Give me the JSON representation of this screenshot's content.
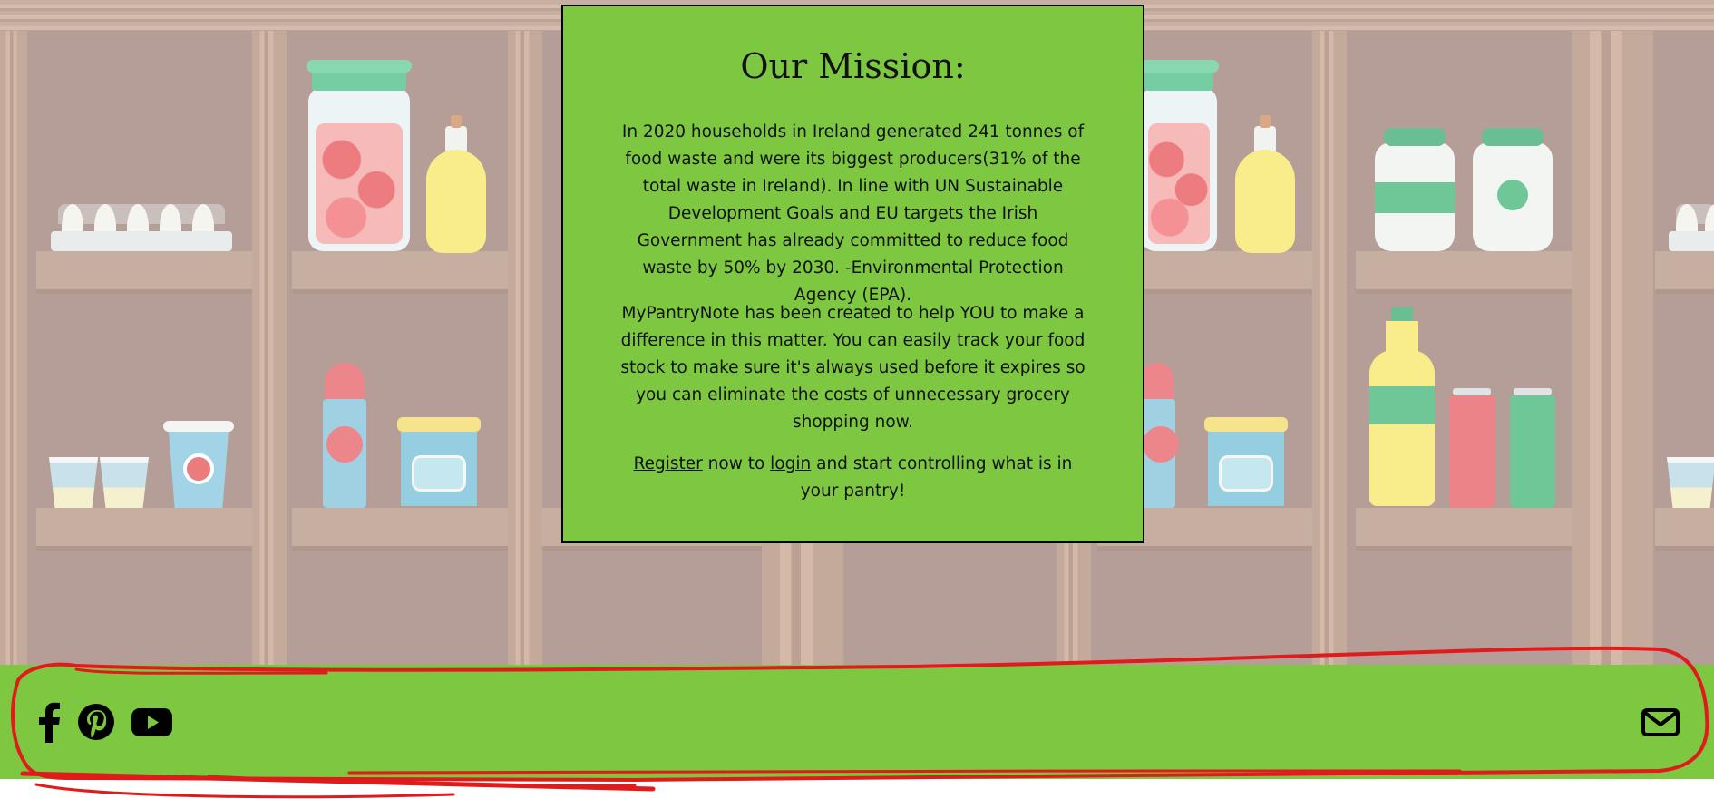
{
  "mission": {
    "title": "Our Mission:",
    "paragraph1": "In 2020 households in Ireland generated 241 tonnes of food waste and were its biggest producers(31% of the total waste in Ireland). In line with UN Sustainable Development Goals and EU targets the Irish Government has already committed to reduce food waste by 50% by 2030. -Environmental Protection Agency (EPA).",
    "paragraph2": "MyPantryNote has been created to help YOU to make a difference in this matter. You can easily track your food stock to make sure it's always used before it expires so you can eliminate the costs of unnecessary grocery shopping now.",
    "cta": {
      "register_link": "Register",
      "text_between": " now to ",
      "login_link": "login",
      "text_after": " and start controlling what is in your pantry!"
    }
  },
  "footer": {
    "social_icons": [
      "facebook-icon",
      "pinterest-icon",
      "youtube-icon"
    ],
    "contact_icon": "envelope-icon"
  },
  "colors": {
    "brand_green": "#7dc741",
    "pantry_wall": "#a1827b",
    "annotation_red": "#e01b1b"
  }
}
